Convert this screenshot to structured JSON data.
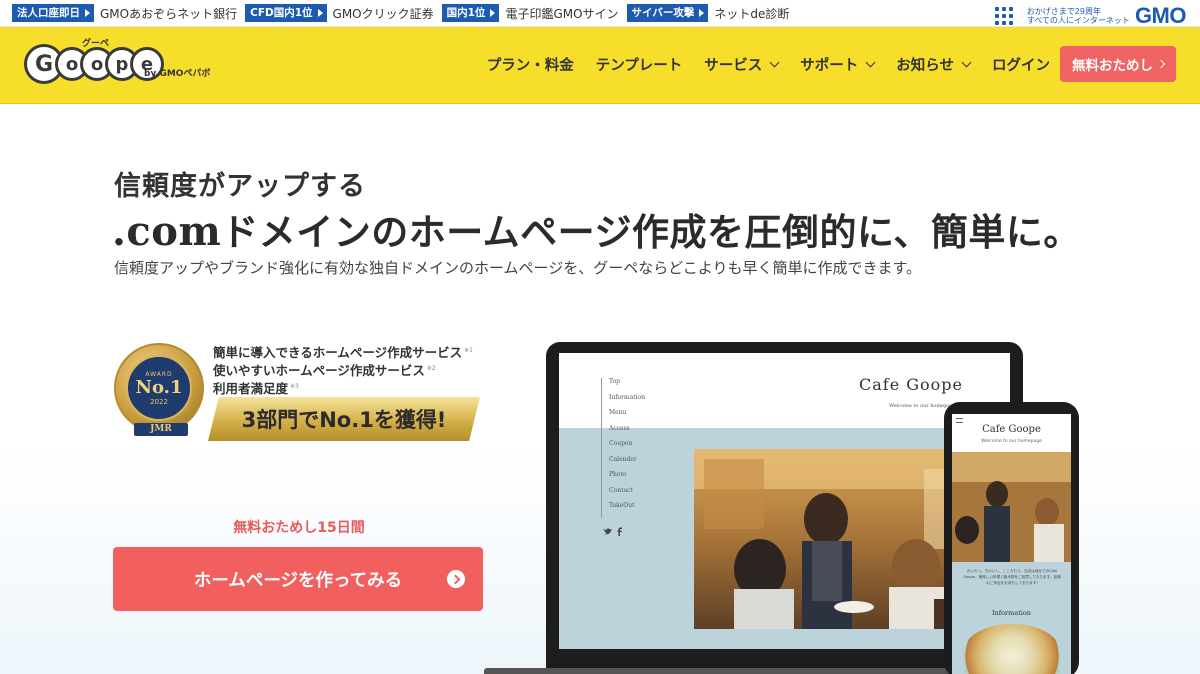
{
  "gmobar": {
    "links": [
      {
        "tag": "法人口座即日",
        "text": "GMOあおぞらネット銀行"
      },
      {
        "tag": "CFD国内1位",
        "text": "GMOクリック証券"
      },
      {
        "tag": "国内1位",
        "text": "電子印鑑GMOサイン"
      },
      {
        "tag": "サイバー攻撃",
        "text": "ネットde診断"
      }
    ],
    "tagline_1": "おかげさまで29周年",
    "tagline_2": "すべての人にインターネット",
    "logo": "GMO"
  },
  "header": {
    "brand_ruby": "グーペ",
    "brand_letters": [
      "G",
      "o",
      "o",
      "p",
      "e"
    ],
    "brand_by": "by GMOペパボ",
    "nav": [
      {
        "label": "プラン・料金",
        "dropdown": false
      },
      {
        "label": "テンプレート",
        "dropdown": false
      },
      {
        "label": "サービス",
        "dropdown": true
      },
      {
        "label": "サポート",
        "dropdown": true
      },
      {
        "label": "お知らせ",
        "dropdown": true
      },
      {
        "label": "ログイン",
        "dropdown": false
      }
    ],
    "trial_button": "無料おためし"
  },
  "hero": {
    "sub_lead": "信頼度がアップする",
    "title_com": ".com",
    "title_rest": "ドメインのホームページ作成を圧倒的に、簡単に。",
    "description": "信頼度アップやブランド強化に有効な独自ドメインのホームページを、グーペならどこよりも早く簡単に作成できます。",
    "award": {
      "medal_award": "AWARD",
      "medal_no1": "No.1",
      "medal_year": "2022",
      "medal_org": "JMR",
      "lines": [
        {
          "text": "簡単に導入できるホームページ作成サービス",
          "note": "※1"
        },
        {
          "text": "使いやすいホームページ作成サービス",
          "note": "※2"
        },
        {
          "text": "利用者満足度",
          "note": "※3"
        }
      ],
      "banner": "3部門でNo.1を獲得!"
    },
    "trial_days": "無料おためし15日間",
    "cta": "ホームページを作ってみる"
  },
  "mockup": {
    "site_title": "Cafe Goope",
    "welcome": "Welcome to our homepage",
    "menu": [
      "Top",
      "Information",
      "Menu",
      "Access",
      "Coupon",
      "Calender",
      "Photo",
      "Contact",
      "TakeOut"
    ],
    "social": [
      "twitter",
      "facebook"
    ],
    "phone_text": "おいらっ。ちわいし、こころもう。当店は地元でのCafe Goope。美味しい料理と飲み物をご用意しております。皆様のご来店をお待ちしております!",
    "phone_info": "Information"
  },
  "colors": {
    "header_yellow": "#f7de2b",
    "accent_red": "#f25f5f",
    "gmo_blue": "#1c5bb0"
  }
}
